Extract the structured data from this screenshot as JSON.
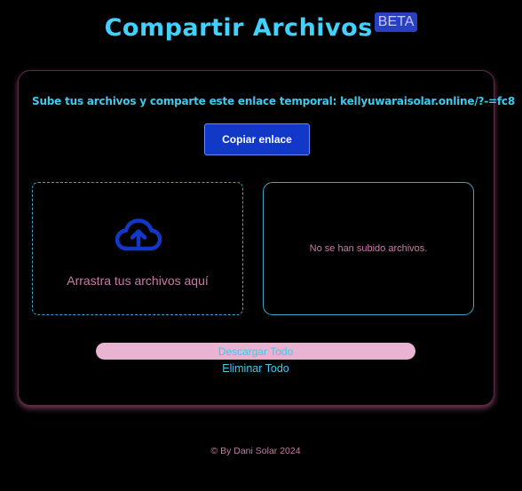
{
  "header": {
    "title": "Compartir Archivos",
    "badge": "BETA"
  },
  "share": {
    "text": "Sube tus archivos y comparte este enlace temporal: kellyuwaraisolar.online/?-=fc8",
    "copy_button": "Copiar enlace"
  },
  "dropzone": {
    "icon": "cloud-upload-icon",
    "label": "Arrastra tus archivos aquí"
  },
  "file_list": {
    "empty_message": "No se han subido archivos."
  },
  "actions": {
    "download_all": "Descargar Todo",
    "delete_all": "Eliminar Todo"
  },
  "footer": {
    "text": "© By Dani Solar 2024"
  },
  "colors": {
    "accent_cyan": "#3fd2ff",
    "primary_blue": "#1238c7",
    "pink_text": "#c97aa6",
    "pink_button": "#e8b4d1"
  }
}
